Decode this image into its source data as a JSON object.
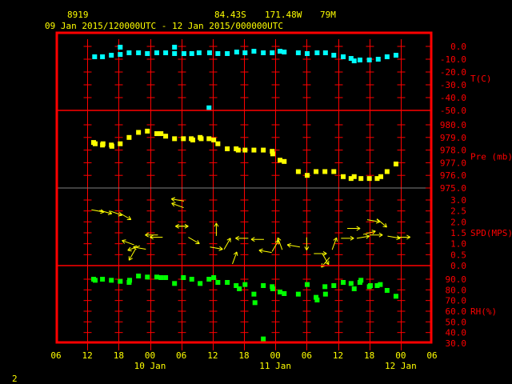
{
  "header": {
    "station": "8919",
    "lat": "84.43S",
    "lon": "171.48W",
    "elev": "79M",
    "range": "09 Jan 2015/120000UTC - 12 Jan 2015/000000UTC"
  },
  "footer": {
    "page": "2"
  },
  "colors": {
    "frame": "#ff0000",
    "text": "#ffff00",
    "temp": "#00ffff",
    "pres": "#ffff00",
    "wind": "#ffff00",
    "rh": "#00ff00",
    "divider": "#808080"
  },
  "chart_data": {
    "type": "scatter",
    "title": "8919 84.43S 171.48W 79M",
    "x_unit": "hours since 09 Jan 2015 12:00 UTC",
    "xlim": [
      -6,
      66
    ],
    "x_ticks": [
      {
        "h": -6,
        "label": "06"
      },
      {
        "h": 0,
        "label": "12"
      },
      {
        "h": 6,
        "label": "18"
      },
      {
        "h": 12,
        "label": "00"
      },
      {
        "h": 18,
        "label": "06"
      },
      {
        "h": 24,
        "label": "12"
      },
      {
        "h": 30,
        "label": "18"
      },
      {
        "h": 36,
        "label": "00"
      },
      {
        "h": 42,
        "label": "06"
      },
      {
        "h": 48,
        "label": "12"
      },
      {
        "h": 54,
        "label": "18"
      },
      {
        "h": 60,
        "label": "00"
      },
      {
        "h": 66,
        "label": "06"
      }
    ],
    "date_labels": [
      {
        "h": 12,
        "label": "10 Jan"
      },
      {
        "h": 36,
        "label": "11 Jan"
      },
      {
        "h": 60,
        "label": "12 Jan"
      }
    ],
    "panels": [
      {
        "id": "temp",
        "label": "T(C)",
        "ylim": [
          -50,
          0
        ],
        "ticks": [
          "0.0",
          "-10.0",
          "-20.0",
          "-30.0",
          "-40.0",
          "-50.0"
        ],
        "tick_values": [
          0,
          -10,
          -20,
          -30,
          -40,
          -50
        ],
        "points": [
          [
            1.4,
            -8.1
          ],
          [
            2.9,
            -8.1
          ],
          [
            4.6,
            -6.9
          ],
          [
            6.3,
            -6.3
          ],
          [
            6.3,
            -0.6
          ],
          [
            8,
            -5
          ],
          [
            9.8,
            -5
          ],
          [
            11.5,
            -5.6
          ],
          [
            13.3,
            -5
          ],
          [
            15,
            -5
          ],
          [
            16.7,
            -5.6
          ],
          [
            16.7,
            -0.6
          ],
          [
            18.5,
            -5.6
          ],
          [
            20,
            -5.6
          ],
          [
            21.4,
            -5
          ],
          [
            23.4,
            -5
          ],
          [
            23.3,
            -48
          ],
          [
            25,
            -5.6
          ],
          [
            26.8,
            -5.6
          ],
          [
            28.6,
            -4.4
          ],
          [
            30.2,
            -5
          ],
          [
            31.9,
            -3.8
          ],
          [
            33.7,
            -5
          ],
          [
            35.4,
            -5
          ],
          [
            36.9,
            -3.8
          ],
          [
            37.7,
            -4.4
          ],
          [
            40.4,
            -5
          ],
          [
            42.1,
            -5.6
          ],
          [
            44,
            -5
          ],
          [
            45.6,
            -5
          ],
          [
            47.2,
            -6.9
          ],
          [
            49,
            -8.1
          ],
          [
            50.5,
            -9.4
          ],
          [
            51.1,
            -11.3
          ],
          [
            52.2,
            -10.6
          ],
          [
            54,
            -10.6
          ],
          [
            55.7,
            -10
          ],
          [
            57.4,
            -8.1
          ],
          [
            59.1,
            -6.9
          ]
        ]
      },
      {
        "id": "pres",
        "label": "Pre (mb)",
        "ylim": [
          975,
          980
        ],
        "ticks": [
          "980.0",
          "979.0",
          "978.0",
          "977.0",
          "976.0",
          "975.0"
        ],
        "tick_values": [
          980,
          979,
          978,
          977,
          976,
          975
        ],
        "points": [
          [
            1.2,
            978.6
          ],
          [
            1.5,
            978.5
          ],
          [
            2.9,
            978.4
          ],
          [
            3,
            978.5
          ],
          [
            4.6,
            978.4
          ],
          [
            4.7,
            978.3
          ],
          [
            6.3,
            978.5
          ],
          [
            8,
            979.0
          ],
          [
            9.8,
            979.4
          ],
          [
            11.5,
            979.5
          ],
          [
            13.3,
            979.3
          ],
          [
            14.1,
            979.3
          ],
          [
            15,
            979.1
          ],
          [
            16.7,
            978.9
          ],
          [
            18.4,
            978.9
          ],
          [
            19.9,
            978.9
          ],
          [
            20.2,
            978.8
          ],
          [
            21.6,
            979.0
          ],
          [
            21.8,
            978.9
          ],
          [
            23.3,
            978.9
          ],
          [
            24.2,
            978.8
          ],
          [
            25,
            978.5
          ],
          [
            26.8,
            978.1
          ],
          [
            28.5,
            978.1
          ],
          [
            28.9,
            978.0
          ],
          [
            30.2,
            978.0
          ],
          [
            31.9,
            978.0
          ],
          [
            33.7,
            978.0
          ],
          [
            35.4,
            977.9
          ],
          [
            35.5,
            977.7
          ],
          [
            36.9,
            977.2
          ],
          [
            37.7,
            977.1
          ],
          [
            40.4,
            976.3
          ],
          [
            42.1,
            976.0
          ],
          [
            43.8,
            976.3
          ],
          [
            45.5,
            976.3
          ],
          [
            47.2,
            976.3
          ],
          [
            49,
            975.9
          ],
          [
            50.5,
            975.75
          ],
          [
            51.1,
            975.9
          ],
          [
            52.4,
            975.75
          ],
          [
            54,
            975.75
          ],
          [
            55.5,
            975.75
          ],
          [
            56.2,
            975.9
          ],
          [
            57.4,
            976.3
          ],
          [
            59.1,
            976.9
          ]
        ]
      },
      {
        "id": "wind",
        "label": "SPD(MPS)",
        "ylim": [
          0,
          3
        ],
        "ticks": [
          "3.0",
          "2.5",
          "2.0",
          "1.5",
          "1.0",
          "0.5",
          "0.0"
        ],
        "tick_values": [
          3,
          2.5,
          2,
          1.5,
          1,
          0.5,
          0
        ],
        "points_h_speed_dir_deg": [
          [
            2,
            2.5,
            -10
          ],
          [
            3.5,
            2.45,
            -15
          ],
          [
            5.5,
            2.4,
            -20
          ],
          [
            7.3,
            2.25,
            -30
          ],
          [
            7.8,
            1.05,
            160
          ],
          [
            8.9,
            0.8,
            200
          ],
          [
            8.6,
            0.5,
            240
          ],
          [
            10,
            0.8,
            170
          ],
          [
            12.3,
            1.4,
            180
          ],
          [
            13.2,
            1.3,
            180
          ],
          [
            17.3,
            3.0,
            170
          ],
          [
            17.3,
            2.75,
            160
          ],
          [
            18.1,
            1.8,
            180
          ],
          [
            18.1,
            1.8,
            0
          ],
          [
            20.4,
            1.15,
            -30
          ],
          [
            24.7,
            1.65,
            90
          ],
          [
            24.7,
            0.8,
            -10
          ],
          [
            26.8,
            1.0,
            60
          ],
          [
            28.2,
            0.35,
            70
          ],
          [
            29.6,
            1.25,
            180
          ],
          [
            32.6,
            1.2,
            180
          ],
          [
            34.1,
            0.65,
            170
          ],
          [
            36,
            0.9,
            60
          ],
          [
            36.9,
            1.0,
            110
          ],
          [
            39.5,
            0.9,
            170
          ],
          [
            42,
            1.0,
            -90
          ],
          [
            44.6,
            0.55,
            0
          ],
          [
            45.6,
            0.15,
            230
          ],
          [
            45.6,
            0.3,
            -60
          ],
          [
            47.3,
            1.0,
            70
          ],
          [
            49.8,
            1.25,
            0
          ],
          [
            51,
            1.7,
            0
          ],
          [
            52.8,
            1.3,
            10
          ],
          [
            54,
            1.5,
            15
          ],
          [
            54.8,
            2.05,
            -10
          ],
          [
            55.3,
            1.4,
            0
          ],
          [
            56.4,
            1.95,
            -40
          ],
          [
            58.7,
            1.3,
            -10
          ],
          [
            60.6,
            1.3,
            0
          ]
        ]
      },
      {
        "id": "rh",
        "label": "RH(%)",
        "ylim": [
          30,
          90
        ],
        "ticks": [
          "90.0",
          "80.0",
          "70.0",
          "60.0",
          "50.0",
          "40.0",
          "30.0"
        ],
        "tick_values": [
          90,
          80,
          70,
          60,
          50,
          40,
          30
        ],
        "points": [
          [
            1.2,
            90
          ],
          [
            1.5,
            89
          ],
          [
            2.9,
            90
          ],
          [
            4.6,
            89
          ],
          [
            6.3,
            88
          ],
          [
            8,
            87
          ],
          [
            8.1,
            89
          ],
          [
            9.8,
            93
          ],
          [
            11.5,
            92
          ],
          [
            13.3,
            92
          ],
          [
            14.1,
            91.5
          ],
          [
            15,
            91.5
          ],
          [
            16.7,
            86
          ],
          [
            18.4,
            91.5
          ],
          [
            20,
            90
          ],
          [
            21.6,
            86
          ],
          [
            23.3,
            90
          ],
          [
            24.2,
            91.5
          ],
          [
            25,
            87
          ],
          [
            26.8,
            87
          ],
          [
            28.5,
            84
          ],
          [
            29.1,
            81
          ],
          [
            30.2,
            85
          ],
          [
            31.9,
            76
          ],
          [
            32.1,
            68
          ],
          [
            33.7,
            84
          ],
          [
            33.7,
            34
          ],
          [
            35.4,
            83
          ],
          [
            35.5,
            81
          ],
          [
            36.9,
            78
          ],
          [
            37.7,
            76.5
          ],
          [
            40.4,
            76
          ],
          [
            42.1,
            85
          ],
          [
            43.8,
            73
          ],
          [
            44,
            70.5
          ],
          [
            45.5,
            83
          ],
          [
            45.6,
            76
          ],
          [
            47.2,
            84
          ],
          [
            49,
            87
          ],
          [
            50.5,
            86
          ],
          [
            51.1,
            81
          ],
          [
            52.2,
            87
          ],
          [
            52.4,
            89
          ],
          [
            54,
            83
          ],
          [
            54.2,
            84
          ],
          [
            55.5,
            84
          ],
          [
            56.1,
            85
          ],
          [
            57.4,
            79.5
          ],
          [
            59.1,
            74
          ]
        ]
      }
    ]
  }
}
